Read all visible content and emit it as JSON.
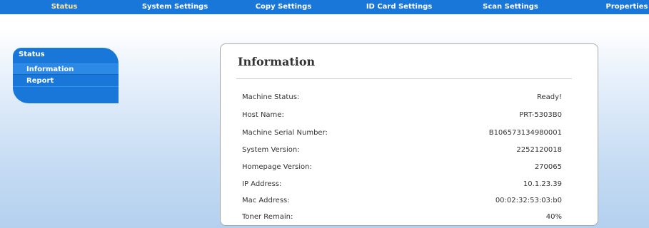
{
  "nav": {
    "items": [
      {
        "label": "Status",
        "active": true
      },
      {
        "label": "System Settings"
      },
      {
        "label": "Copy Settings"
      },
      {
        "label": "ID Card Settings"
      },
      {
        "label": "Scan Settings"
      },
      {
        "label": "Properties"
      }
    ]
  },
  "sidebar": {
    "title": "Status",
    "items": [
      {
        "label": "Information",
        "selected": true
      },
      {
        "label": "Report"
      }
    ]
  },
  "panel": {
    "title": "Information",
    "rows": [
      {
        "label": "Machine Status:",
        "value": "Ready!"
      },
      {
        "label": "Host Name:",
        "value": "PRT-5303B0"
      },
      {
        "label": "Machine Serial Number:",
        "value": "B106573134980001"
      },
      {
        "label": "System Version:",
        "value": "2252120018"
      },
      {
        "label": "Homepage Version:",
        "value": "270065"
      },
      {
        "label": "IP Address:",
        "value": "10.1.23.39"
      },
      {
        "label": "Mac Address:",
        "value": "00:02:32:53:03:b0"
      },
      {
        "label": "Toner Remain:",
        "value": "40%"
      }
    ]
  },
  "colors": {
    "nav_bg": "#1877d8",
    "nav_active_text": "#ffe69a",
    "sidebar_bg": "#1877d8",
    "sidebar_selected": "#2c8ae6"
  }
}
